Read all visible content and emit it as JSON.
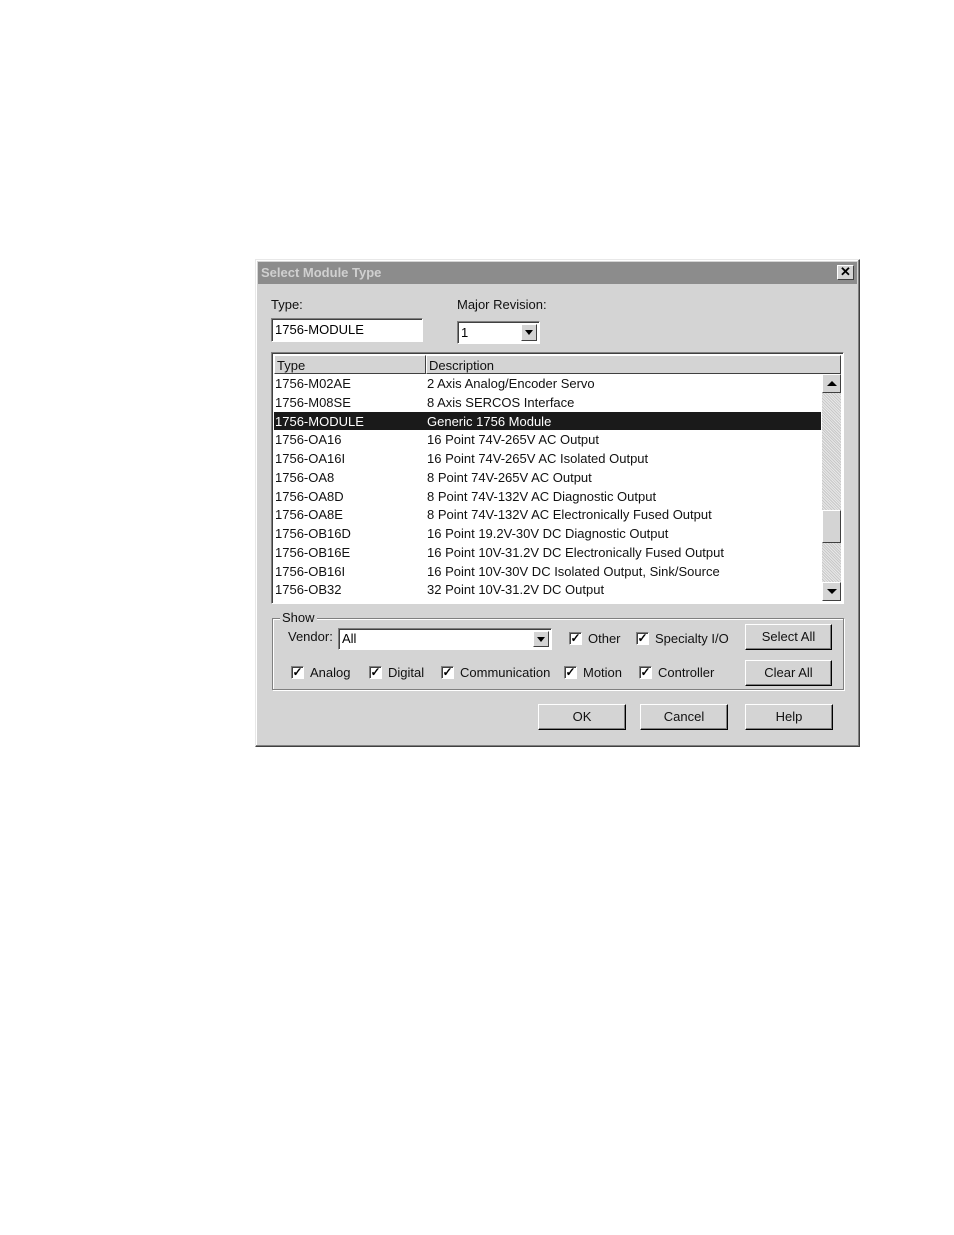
{
  "dialog": {
    "title": "Select Module Type",
    "close_glyph": "✕"
  },
  "type_field": {
    "label": "Type:",
    "value": "1756-MODULE"
  },
  "major_revision": {
    "label": "Major Revision:",
    "value": "1"
  },
  "module_list": {
    "columns": [
      "Type",
      "Description"
    ],
    "rows": [
      {
        "type": "1756-M02AE",
        "description": "2 Axis Analog/Encoder Servo"
      },
      {
        "type": "1756-M08SE",
        "description": "8 Axis SERCOS Interface"
      },
      {
        "type": "1756-MODULE",
        "description": "Generic 1756 Module",
        "selected": true
      },
      {
        "type": "1756-OA16",
        "description": "16 Point 74V-265V AC Output"
      },
      {
        "type": "1756-OA16I",
        "description": "16 Point 74V-265V AC Isolated Output"
      },
      {
        "type": "1756-OA8",
        "description": "8 Point 74V-265V AC Output"
      },
      {
        "type": "1756-OA8D",
        "description": "8 Point 74V-132V AC Diagnostic Output"
      },
      {
        "type": "1756-OA8E",
        "description": "8 Point 74V-132V AC Electronically Fused Output"
      },
      {
        "type": "1756-OB16D",
        "description": "16 Point 19.2V-30V DC Diagnostic Output"
      },
      {
        "type": "1756-OB16E",
        "description": "16 Point 10V-31.2V DC Electronically Fused Output"
      },
      {
        "type": "1756-OB16I",
        "description": "16 Point 10V-30V DC Isolated Output, Sink/Source"
      },
      {
        "type": "1756-OB32",
        "description": "32 Point 10V-31.2V DC Output"
      }
    ]
  },
  "show": {
    "group_label": "Show",
    "vendor_label": "Vendor:",
    "vendor_value": "All",
    "checkboxes": {
      "other": {
        "label": "Other",
        "checked": true
      },
      "specialty": {
        "label": "Specialty I/O",
        "checked": true
      },
      "analog": {
        "label": "Analog",
        "checked": true
      },
      "digital": {
        "label": "Digital",
        "checked": true
      },
      "communication": {
        "label": "Communication",
        "checked": true
      },
      "motion": {
        "label": "Motion",
        "checked": true
      },
      "controller": {
        "label": "Controller",
        "checked": true
      }
    },
    "check_glyph": "✓",
    "select_all": "Select All",
    "clear_all": "Clear All"
  },
  "buttons": {
    "ok": "OK",
    "cancel": "Cancel",
    "help": "Help"
  }
}
